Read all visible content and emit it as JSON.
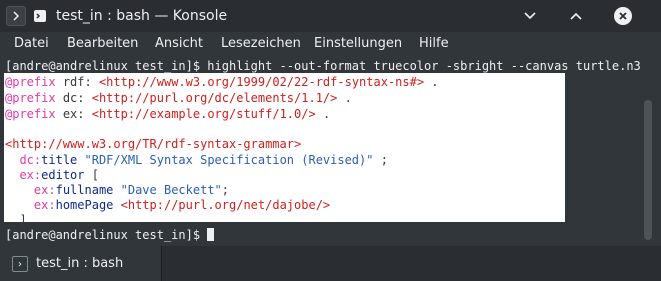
{
  "window": {
    "title": "test_in : bash — Konsole",
    "app_icon": "terminal-icon",
    "controls": [
      "chevron-down-icon",
      "chevron-up-icon",
      "close-icon"
    ]
  },
  "menu": {
    "items": [
      "Datei",
      "Bearbeiten",
      "Ansicht",
      "Lesezeichen",
      "Einstellungen",
      "Hilfe"
    ]
  },
  "terminal": {
    "command_line": "[andre@andrelinux test_in]$ highlight --out-format truecolor -sbright --canvas turtle.n3",
    "prompt_line": "[andre@andrelinux test_in]$ ",
    "output": {
      "l1": {
        "kw": "@prefix",
        "ns": "rdf:",
        "uri": "<http://www.w3.org/1999/02/22-rdf-syntax-ns#>",
        "end": "."
      },
      "l2": {
        "kw": "@prefix",
        "ns": "dc:",
        "uri": "<http://purl.org/dc/elements/1.1/>",
        "end": "."
      },
      "l3": {
        "kw": "@prefix",
        "ns": "ex:",
        "uri": "<http://example.org/stuff/1.0/>",
        "end": "."
      },
      "l5": {
        "uri": "<http://www.w3.org/TR/rdf-syntax-grammar>"
      },
      "l6": {
        "ns": "dc:",
        "term": "title",
        "str": "\"RDF/XML Syntax Specification (Revised)\"",
        "end": ";"
      },
      "l7": {
        "ns": "ex:",
        "term": "editor",
        "end": "["
      },
      "l8": {
        "ns": "ex:",
        "term": "fullname",
        "str": "\"Dave Beckett\"",
        "end": ";"
      },
      "l9": {
        "ns": "ex:",
        "term": "homePage",
        "uri": "<http://purl.org/net/dajobe/>"
      },
      "l10": {
        "end": "] ."
      }
    },
    "colors": {
      "canvas_bg": "#ffffff",
      "keyword": "#e03aa6",
      "uri": "#d0201e",
      "term": "#0f2a8c",
      "string": "#2b5fb5"
    }
  },
  "tabs": [
    {
      "label": "test_in : bash",
      "icon": "terminal-icon"
    }
  ]
}
